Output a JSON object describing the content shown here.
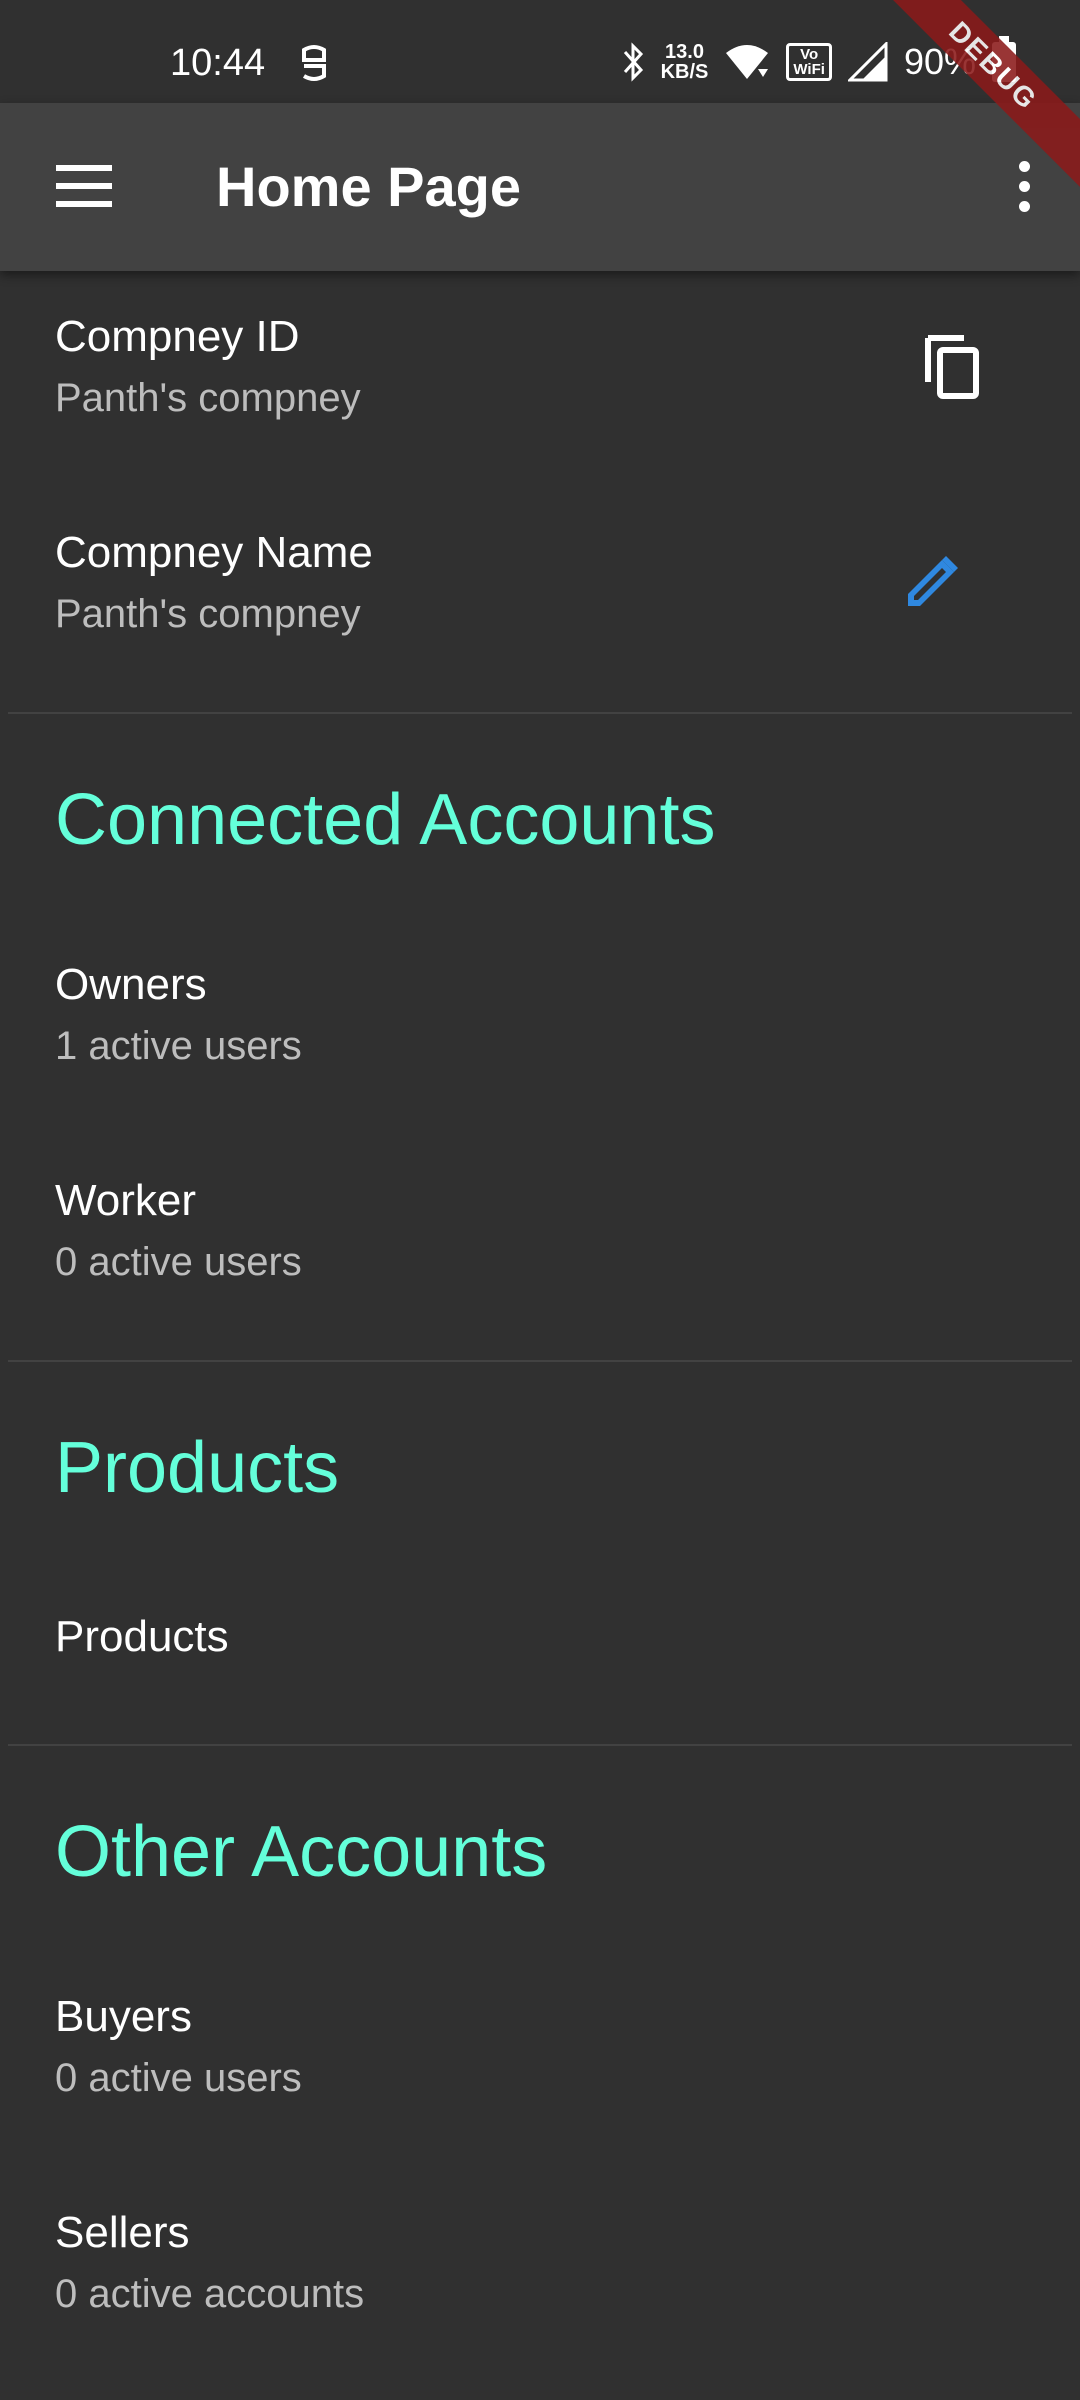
{
  "status_bar": {
    "time": "10:44",
    "net_speed_value": "13.0",
    "net_speed_unit": "KB/S",
    "volte_top": "Vo",
    "volte_bottom": "WiFi",
    "battery": "90%"
  },
  "debug_banner": "DEBUG",
  "app_bar": {
    "title": "Home Page",
    "menu_icon": "hamburger-menu-icon",
    "more_icon": "more-vert-icon"
  },
  "company": {
    "id_title": "Compney ID",
    "id_value": "Panth's compney",
    "id_action_icon": "copy-icon",
    "name_title": "Compney Name",
    "name_value": "Panth's compney",
    "name_action_icon": "edit-icon"
  },
  "connected_accounts": {
    "heading": "Connected Accounts",
    "items": [
      {
        "title": "Owners",
        "subtitle": "1 active users"
      },
      {
        "title": "Worker",
        "subtitle": "0 active users"
      }
    ]
  },
  "products": {
    "heading": "Products",
    "items": [
      {
        "title": "Products"
      }
    ]
  },
  "other_accounts": {
    "heading": "Other Accounts",
    "items": [
      {
        "title": "Buyers",
        "subtitle": "0 active users"
      },
      {
        "title": "Sellers",
        "subtitle": "0 active accounts"
      }
    ]
  },
  "colors": {
    "background": "#303030",
    "app_bar": "#424242",
    "accent": "#64ffda",
    "edit_icon": "#2f88e0"
  }
}
